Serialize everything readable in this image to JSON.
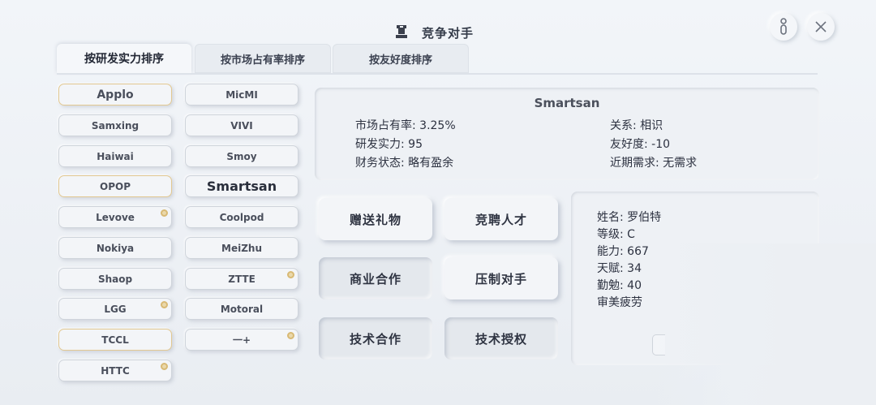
{
  "header": {
    "title": "竞争对手",
    "icon": "chess-rook-icon",
    "help_icon": "info-icon",
    "close_icon": "close-icon"
  },
  "tabs": [
    {
      "label": "按研发实力排序",
      "active": true
    },
    {
      "label": "按市场占有率排序",
      "active": false
    },
    {
      "label": "按友好度排序",
      "active": false
    }
  ],
  "companies_left": [
    {
      "name": "Applo",
      "highlight": true,
      "badge": false
    },
    {
      "name": "Samxing",
      "highlight": false,
      "badge": false
    },
    {
      "name": "Haiwai",
      "highlight": false,
      "badge": false
    },
    {
      "name": "OPOP",
      "highlight": true,
      "badge": false
    },
    {
      "name": "Levove",
      "highlight": false,
      "badge": true
    },
    {
      "name": "Nokiya",
      "highlight": false,
      "badge": false
    },
    {
      "name": "Shaop",
      "highlight": false,
      "badge": false
    },
    {
      "name": "LGG",
      "highlight": false,
      "badge": true
    },
    {
      "name": "TCCL",
      "highlight": true,
      "badge": false
    },
    {
      "name": "HTTC",
      "highlight": false,
      "badge": true
    }
  ],
  "companies_right": [
    {
      "name": "MicMI",
      "highlight": false,
      "badge": false
    },
    {
      "name": "VIVI",
      "highlight": false,
      "badge": false
    },
    {
      "name": "Smoy",
      "highlight": false,
      "badge": false
    },
    {
      "name": "Smartsan",
      "highlight": false,
      "badge": false,
      "selected": true
    },
    {
      "name": "Coolpod",
      "highlight": false,
      "badge": false
    },
    {
      "name": "MeiZhu",
      "highlight": false,
      "badge": false
    },
    {
      "name": "ZTTE",
      "highlight": false,
      "badge": true
    },
    {
      "name": "Motoral",
      "highlight": false,
      "badge": false
    },
    {
      "name": "一+",
      "highlight": false,
      "badge": true
    }
  ],
  "selected_company": {
    "name": "Smartsan",
    "market_share": "市场占有率: 3.25%",
    "rd_strength": "研发实力: 95",
    "finance": "财务状态: 略有盈余",
    "relation": "关系: 相识",
    "friendliness": "友好度: -10",
    "demand": "近期需求: 无需求"
  },
  "actions": [
    {
      "label": "赠送礼物",
      "pressed": false
    },
    {
      "label": "竞聘人才",
      "pressed": false
    },
    {
      "label": "商业合作",
      "pressed": true
    },
    {
      "label": "压制对手",
      "pressed": false
    },
    {
      "label": "技术合作",
      "pressed": true
    },
    {
      "label": "技术授权",
      "pressed": true
    }
  ],
  "talent": {
    "name": "姓名: 罗伯特",
    "level": "等级: C",
    "ability": "能力: 667",
    "talent": "天赋: 34",
    "diligence": "勤勉: 40",
    "trait": "审美疲劳"
  },
  "colors": {
    "background": "#eef1f5",
    "badge": "#d8b974",
    "text": "#2c3140"
  }
}
